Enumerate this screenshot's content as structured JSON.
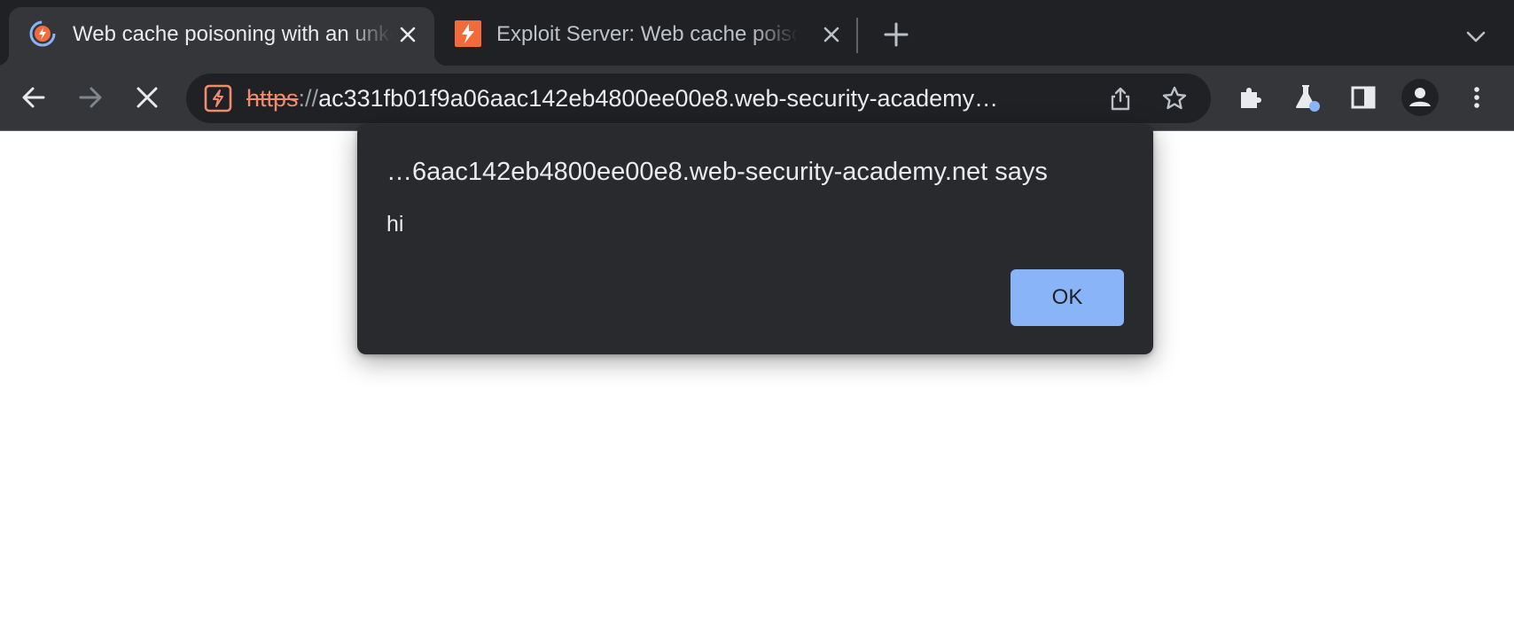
{
  "tabs": [
    {
      "title": "Web cache poisoning with an unkeyed header",
      "active": true,
      "favicon": "portswigger-loading-icon"
    },
    {
      "title": "Exploit Server: Web cache poisoning",
      "active": false,
      "favicon": "burp-exploit-icon"
    }
  ],
  "toolbar": {
    "url_scheme": "https",
    "url_separator": "://",
    "url_rest": "ac331fb01f9a06aac142eb4800ee00e8.web-security-academy…"
  },
  "dialog": {
    "title": "…6aac142eb4800ee00e8.web-security-academy.net says",
    "message": "hi",
    "ok_label": "OK"
  },
  "colors": {
    "tabstrip": "#202124",
    "toolbar": "#35363a",
    "omnibox": "#202124",
    "dialog": "#292a2d",
    "ok_button": "#8ab4f8",
    "insecure_scheme": "#f28b6b"
  }
}
